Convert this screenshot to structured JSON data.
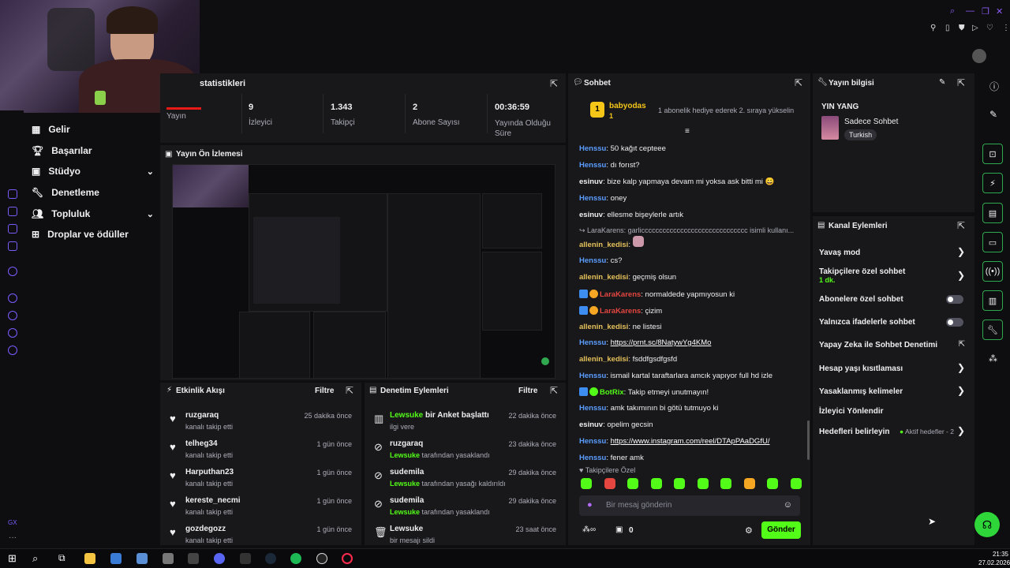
{
  "stats": {
    "title": "statistikleri",
    "items": [
      {
        "value": "",
        "label": "Yayın"
      },
      {
        "value": "9",
        "label": "İzleyici"
      },
      {
        "value": "1.343",
        "label": "Takipçi"
      },
      {
        "value": "2",
        "label": "Abone Sayısı"
      },
      {
        "value": "00:36:59",
        "label": "Yayında Olduğu Süre"
      }
    ]
  },
  "nav": {
    "items": [
      {
        "label": "Gelir"
      },
      {
        "label": "Başarılar"
      },
      {
        "label": "Stüdyo"
      },
      {
        "label": "Denetleme"
      },
      {
        "label": "Topluluk"
      },
      {
        "label": "Droplar ve ödüller"
      }
    ]
  },
  "preview": {
    "title": "Yayın Ön İzlemesi"
  },
  "activity": {
    "title": "Etkinlik Akışı",
    "filter": "Filtre",
    "rows": [
      {
        "user": "ruzgaraq",
        "desc": "kanalı takip etti",
        "time": "25 dakika önce"
      },
      {
        "user": "telheg34",
        "desc": "kanalı takip etti",
        "time": "1 gün önce"
      },
      {
        "user": "Harputhan23",
        "desc": "kanalı takip etti",
        "time": "1 gün önce"
      },
      {
        "user": "kereste_necmi",
        "desc": "kanalı takip etti",
        "time": "1 gün önce"
      },
      {
        "user": "gozdegozz",
        "desc": "kanalı takip etti",
        "time": "1 gün önce"
      }
    ]
  },
  "moderation": {
    "title": "Denetim Eylemleri",
    "filter": "Filtre",
    "rows": [
      {
        "user": "Lewsuke",
        "action": "bir Anket başlattı",
        "sub_user": "",
        "sub": "ilgi vere",
        "time": "22 dakika önce"
      },
      {
        "user": "ruzgaraq",
        "action": "",
        "sub_user": "Lewsuke",
        "sub": "tarafından yasaklandı",
        "time": "23 dakika önce"
      },
      {
        "user": "sudemila",
        "action": "",
        "sub_user": "Lewsuke",
        "sub": "tarafından yasağı kaldırıldı",
        "time": "29 dakika önce"
      },
      {
        "user": "sudemila",
        "action": "",
        "sub_user": "Lewsuke",
        "sub": "tarafından yasaklandı",
        "time": "29 dakika önce"
      },
      {
        "user": "Lewsuke",
        "action": "",
        "sub_user": "",
        "sub": "bir mesajı sildi",
        "time": "23 saat önce"
      }
    ]
  },
  "chat": {
    "title": "Sohbet",
    "pinned_user": "babyodas",
    "pinned_count": "1",
    "pinned_msg": "1 abonelik hediye ederek 2. sıraya yükselin",
    "messages": [
      {
        "user": "Henssu",
        "color": "blue",
        "text": ": 50 kağıt cepteee"
      },
      {
        "user": "Henssu",
        "color": "blue",
        "text": ": dı forıst?"
      },
      {
        "user": "esinuv",
        "color": "white",
        "text": ": bize kalp yapmaya devam mi yoksa ask bitti mi 😀"
      },
      {
        "user": "Henssu",
        "color": "blue",
        "text": ": oney"
      },
      {
        "user": "esinuv",
        "color": "white",
        "text": ": ellesme bişeylerle artık"
      },
      {
        "user": "LaraKarens",
        "color": "reply",
        "text": ": garlicccccccccccccccccccccccccccccc isimli kullanı..."
      },
      {
        "user": "allenin_kedisi",
        "color": "yellow",
        "text": ":"
      },
      {
        "user": "Henssu",
        "color": "blue",
        "text": ": cs?"
      },
      {
        "user": "allenin_kedisi",
        "color": "yellow",
        "text": ": geçmiş olsun"
      },
      {
        "user": "LaraKarens",
        "color": "red",
        "text": ": normaldede yapmıyosun ki"
      },
      {
        "user": "LaraKarens",
        "color": "red",
        "text": ": çizim"
      },
      {
        "user": "allenin_kedisi",
        "color": "yellow",
        "text": ": ne listesi"
      },
      {
        "user": "Henssu",
        "color": "blue",
        "text": ": ",
        "link": "https://prnt.sc/8NatywYg4KMo"
      },
      {
        "user": "allenin_kedisi",
        "color": "yellow",
        "text": ": fsddfgsdfgsfd"
      },
      {
        "user": "Henssu",
        "color": "blue",
        "text": ": ismail kartal taraftarlara amcık yapıyor full hd izle"
      },
      {
        "user": "BotRix",
        "color": "green",
        "text": ": Takip etmeyi unutmayın!"
      },
      {
        "user": "Henssu",
        "color": "blue",
        "text": ": amk takımının bi götü tutmuyo ki"
      },
      {
        "user": "esinuv",
        "color": "white",
        "text": ": opelim gecsin"
      },
      {
        "user": "Henssu",
        "color": "blue",
        "text": ": ",
        "link": "https://www.instagram.com/reel/DTApPAaDGfU/"
      },
      {
        "user": "Henssu",
        "color": "blue",
        "text": ": fener amk"
      }
    ],
    "followers_only": "Takipçilere Özel",
    "input_placeholder": "Bir mesaj gönderin",
    "count": "0",
    "send": "Gönder"
  },
  "stream_info": {
    "title": "Yayın bilgisi",
    "stream_title": "YIN YANG",
    "category": "Sadece Sohbet",
    "tag": "Turkish"
  },
  "channel_actions": {
    "title": "Kanal Eylemleri",
    "items": [
      {
        "label": "Yavaş mod",
        "sub": "",
        "control": "chevron"
      },
      {
        "label": "Takipçilere özel sohbet",
        "sub": "1 dk.",
        "control": "chevron"
      },
      {
        "label": "Abonelere özel sohbet",
        "sub": "",
        "control": "toggle"
      },
      {
        "label": "Yalnızca ifadelerle sohbet",
        "sub": "",
        "control": "toggle"
      },
      {
        "label": "Yapay Zeka ile Sohbet Denetimi",
        "sub": "",
        "control": "external"
      },
      {
        "label": "Hesap yaşı kısıtlaması",
        "sub": "",
        "control": "chevron"
      },
      {
        "label": "Yasaklanmış kelimeler",
        "sub": "",
        "control": "chevron"
      },
      {
        "label": "İzleyici Yönlendir",
        "sub": "",
        "control": "none"
      },
      {
        "label": "Hedefleri belirleyin",
        "sub": "",
        "control": "chevron",
        "note": "Aktif hedefler - 2"
      }
    ]
  },
  "taskbar": {
    "time": "21:35",
    "date": "27.02.2026"
  },
  "colors": {
    "accent": "#53fc18",
    "panel": "#18181b",
    "bg": "#0e0e10"
  }
}
